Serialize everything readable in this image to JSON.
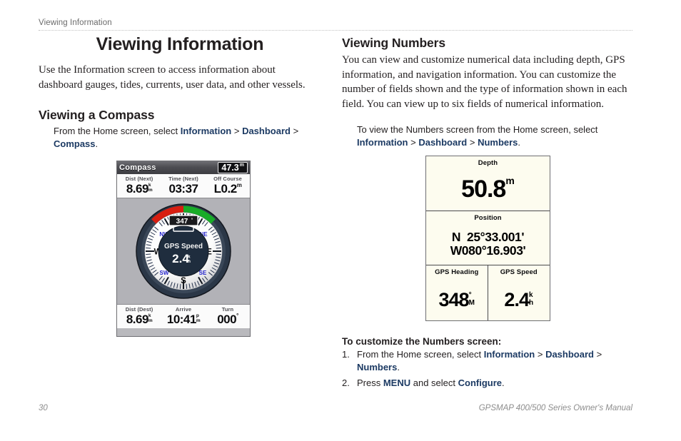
{
  "header": {
    "running_head": "Viewing Information"
  },
  "footer": {
    "page_number": "30",
    "manual_title": "GPSMAP 400/500 Series Owner's Manual"
  },
  "left_column": {
    "doc_title": "Viewing Information",
    "intro_paragraph": "Use the Information screen to access information about dashboard gauges, tides, currents, user data, and other vessels.",
    "section_title": "Viewing a Compass",
    "instruction": {
      "lead": "From the Home screen, select ",
      "link1": "Information",
      "sep1": " > ",
      "link2": "Dashboard",
      "sep2": " > ",
      "link3": "Compass",
      "end": "."
    }
  },
  "right_column": {
    "section_title": "Viewing Numbers",
    "intro_paragraph": "You can view and customize numerical data including depth, GPS information, and navigation information. You can customize the number of fields shown and the type of information shown in each field. You can view up to six fields of numerical information.",
    "instruction": {
      "lead": "To view the Numbers screen from the Home screen, select ",
      "link1": "Information",
      "sep1": " > ",
      "link2": "Dashboard",
      "sep2": " > ",
      "link3": "Numbers",
      "end": "."
    },
    "procedure_title": "To customize the Numbers screen:",
    "steps": [
      {
        "num": "1.",
        "lead": "From the Home screen, select ",
        "link1": "Information",
        "sep1": " > ",
        "link2": "Dashboard",
        "sep2": " > ",
        "link3": "Numbers",
        "end": "."
      },
      {
        "num": "2.",
        "lead": "Press ",
        "link1": "MENU",
        "sep1": " and select ",
        "link2": "Configure",
        "sep2": "",
        "link3": "",
        "end": "."
      }
    ]
  },
  "compass_screen": {
    "title": "Compass",
    "depth_value": "47.3",
    "depth_unit": "m",
    "top_fields": [
      {
        "label": "Dist (Next)",
        "value": "8.69",
        "unit_top": "k",
        "unit_bottom": "m",
        "unit_style": "stack"
      },
      {
        "label": "Time (Next)",
        "value": "03:37",
        "unit_top": "",
        "unit_bottom": "",
        "unit_style": "none"
      },
      {
        "label": "Off Course",
        "value": "L0.2",
        "unit_top": "m",
        "unit_bottom": "",
        "unit_style": "sup"
      }
    ],
    "bottom_fields": [
      {
        "label": "Dist (Dest)",
        "value": "8.69",
        "unit_top": "k",
        "unit_bottom": "m",
        "unit_style": "stack"
      },
      {
        "label": "Arrive",
        "value": "10:41",
        "unit_top": "p",
        "unit_bottom": "m",
        "unit_style": "stack"
      },
      {
        "label": "Turn",
        "value": "000",
        "unit_top": "°",
        "unit_bottom": "",
        "unit_style": "sup"
      }
    ],
    "rose": {
      "heading_value": "347",
      "heading_unit": "°",
      "center_label": "GPS Speed",
      "center_value": "2.4",
      "center_unit_top": "k",
      "center_unit_bottom": "n",
      "cardinals": [
        "N",
        "E",
        "S",
        "W"
      ],
      "intercardinals": [
        "NE",
        "SE",
        "SW",
        "NW"
      ],
      "arc_red_color": "#d81e11",
      "arc_green_color": "#19ac28",
      "ring_color": "#2b3747",
      "bezel_color": "#f4f4f4",
      "hub_color": "#1f2d3e",
      "intercardinal_color": "#2222cc"
    }
  },
  "numbers_screen": {
    "panels": [
      {
        "label": "Depth",
        "value": "50.8",
        "unit_sup": "m"
      },
      {
        "label": "Position",
        "value_line1": "N  25°33.001'",
        "value_line2": "W080°16.903'"
      },
      {
        "label": "GPS Heading",
        "value": "348",
        "unit_sup": "°",
        "unit_after": "M"
      },
      {
        "label": "GPS Speed",
        "value": "2.4",
        "unit_top": "k",
        "unit_bottom": "h"
      }
    ]
  },
  "colors": {
    "link_blue": "#1c3a63",
    "text_black": "#231f20",
    "footer_gray": "#8d8d8d",
    "device_bezel_gray": "#b2b2b7",
    "numbers_bg": "#fdfcef"
  }
}
